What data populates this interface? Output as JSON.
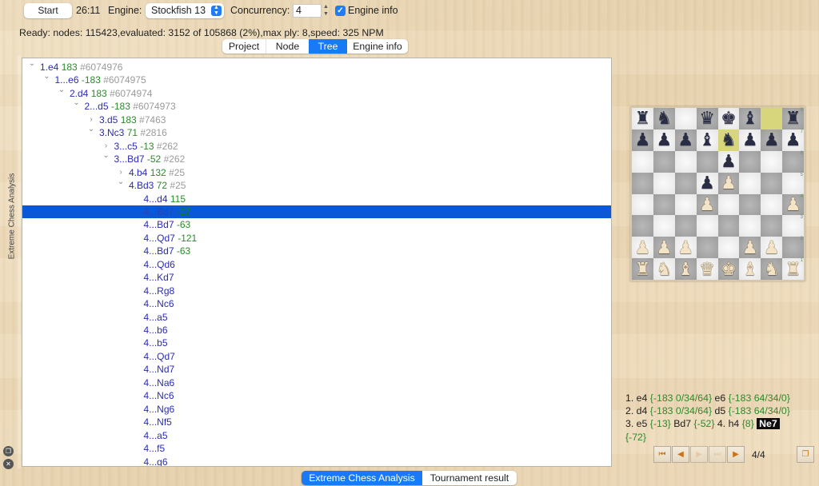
{
  "toolbar": {
    "start_label": "Start",
    "timer": "26:11",
    "engine_label": "Engine:",
    "engine_value": "Stockfish 13",
    "concurrency_label": "Concurrency:",
    "concurrency_value": "4",
    "engine_info_checkbox_label": "Engine info",
    "engine_info_checked": true
  },
  "status": "Ready: nodes: 115423,evaluated: 3152 of 105868 (2%),max ply: 8,speed: 325 NPM",
  "view_tabs": [
    {
      "label": "Project",
      "active": false
    },
    {
      "label": "Node",
      "active": false
    },
    {
      "label": "Tree",
      "active": true
    },
    {
      "label": "Engine info",
      "active": false
    }
  ],
  "side_panel_label": "Extreme Chess Analysis",
  "tree": [
    {
      "depth": 0,
      "toggle": "expanded",
      "move": "1.e4",
      "score": "183",
      "count": "#6074976"
    },
    {
      "depth": 1,
      "toggle": "expanded",
      "move": "1...e6",
      "score": "-183",
      "count": "#6074975"
    },
    {
      "depth": 2,
      "toggle": "expanded",
      "move": "2.d4",
      "score": "183",
      "count": "#6074974"
    },
    {
      "depth": 3,
      "toggle": "expanded",
      "move": "2...d5",
      "score": "-183",
      "count": "#6074973"
    },
    {
      "depth": 4,
      "toggle": "collapsed",
      "move": "3.d5",
      "score": "183",
      "count": "#7463"
    },
    {
      "depth": 4,
      "toggle": "expanded",
      "move": "3.Nc3",
      "score": "71",
      "count": "#2816"
    },
    {
      "depth": 5,
      "toggle": "collapsed",
      "move": "3...c5",
      "score": "-13",
      "count": "#262"
    },
    {
      "depth": 5,
      "toggle": "expanded",
      "move": "3...Bd7",
      "score": "-52",
      "count": "#262"
    },
    {
      "depth": 6,
      "toggle": "collapsed",
      "move": "4.b4",
      "score": "132",
      "count": "#25"
    },
    {
      "depth": 6,
      "toggle": "expanded",
      "move": "4.Bd3",
      "score": "72",
      "count": "#25"
    },
    {
      "depth": 7,
      "toggle": "",
      "move": "4...d4",
      "score": "115",
      "count": ""
    },
    {
      "depth": 7,
      "toggle": "",
      "move": "4...Bd7",
      "score": "-27",
      "count": "",
      "selected": true
    },
    {
      "depth": 7,
      "toggle": "",
      "move": "4...Bd7",
      "score": "-63",
      "count": ""
    },
    {
      "depth": 7,
      "toggle": "",
      "move": "4...Qd7",
      "score": "-121",
      "count": ""
    },
    {
      "depth": 7,
      "toggle": "",
      "move": "4...Bd7",
      "score": "-63",
      "count": ""
    },
    {
      "depth": 7,
      "toggle": "",
      "move": "4...Qd6",
      "score": "",
      "count": ""
    },
    {
      "depth": 7,
      "toggle": "",
      "move": "4...Kd7",
      "score": "",
      "count": ""
    },
    {
      "depth": 7,
      "toggle": "",
      "move": "4...Rg8",
      "score": "",
      "count": ""
    },
    {
      "depth": 7,
      "toggle": "",
      "move": "4...Nc6",
      "score": "",
      "count": ""
    },
    {
      "depth": 7,
      "toggle": "",
      "move": "4...a5",
      "score": "",
      "count": ""
    },
    {
      "depth": 7,
      "toggle": "",
      "move": "4...b6",
      "score": "",
      "count": ""
    },
    {
      "depth": 7,
      "toggle": "",
      "move": "4...b5",
      "score": "",
      "count": ""
    },
    {
      "depth": 7,
      "toggle": "",
      "move": "4...Qd7",
      "score": "",
      "count": ""
    },
    {
      "depth": 7,
      "toggle": "",
      "move": "4...Nd7",
      "score": "",
      "count": ""
    },
    {
      "depth": 7,
      "toggle": "",
      "move": "4...Na6",
      "score": "",
      "count": ""
    },
    {
      "depth": 7,
      "toggle": "",
      "move": "4...Nc6",
      "score": "",
      "count": ""
    },
    {
      "depth": 7,
      "toggle": "",
      "move": "4...Ng6",
      "score": "",
      "count": ""
    },
    {
      "depth": 7,
      "toggle": "",
      "move": "4...Nf5",
      "score": "",
      "count": ""
    },
    {
      "depth": 7,
      "toggle": "",
      "move": "4...a5",
      "score": "",
      "count": ""
    },
    {
      "depth": 7,
      "toggle": "",
      "move": "4...f5",
      "score": "",
      "count": ""
    },
    {
      "depth": 7,
      "toggle": "",
      "move": "4...g6",
      "score": "",
      "count": ""
    }
  ],
  "board": {
    "ranks": [
      [
        "r",
        "n",
        "",
        "q",
        "k",
        "b",
        "",
        "r"
      ],
      [
        "p",
        "p",
        "p",
        "b",
        "n",
        "p",
        "p",
        "p"
      ],
      [
        "",
        "",
        "",
        "",
        "p",
        "",
        "",
        ""
      ],
      [
        "",
        "",
        "",
        "p",
        "P",
        "",
        "",
        ""
      ],
      [
        "",
        "",
        "",
        "P",
        "",
        "",
        "",
        "P"
      ],
      [
        "",
        "",
        "",
        "",
        "",
        "",
        "",
        ""
      ],
      [
        "P",
        "P",
        "P",
        "",
        "",
        "P",
        "P",
        ""
      ],
      [
        "R",
        "N",
        "B",
        "Q",
        "K",
        "B",
        "N",
        "R"
      ]
    ],
    "highlighted_squares": [
      "g8",
      "e7"
    ],
    "rank_labels": [
      "8",
      "7",
      "6",
      "5",
      "4",
      "3",
      "2",
      "1"
    ],
    "file_labels": [
      "a",
      "b",
      "c",
      "d",
      "e",
      "f",
      "g",
      "h"
    ]
  },
  "pgn": [
    {
      "t": "1. e4 ",
      "k": "mv"
    },
    {
      "t": "{-183 0/34/64}",
      "k": "cm"
    },
    {
      "t": " e6 ",
      "k": "mv"
    },
    {
      "t": "{-183 64/34/0}",
      "k": "cm"
    },
    {
      "t": "br",
      "k": "br"
    },
    {
      "t": " 2. d4 ",
      "k": "mv"
    },
    {
      "t": "{-183 0/34/64}",
      "k": "cm"
    },
    {
      "t": " d5 ",
      "k": "mv"
    },
    {
      "t": "{-183 64/34/0}",
      "k": "cm"
    },
    {
      "t": "br",
      "k": "br"
    },
    {
      "t": " 3. e5 ",
      "k": "mv"
    },
    {
      "t": "{-13}",
      "k": "cm"
    },
    {
      "t": " Bd7 ",
      "k": "mv"
    },
    {
      "t": "{-52}",
      "k": "cm"
    },
    {
      "t": "  4. h4 ",
      "k": "mv"
    },
    {
      "t": "{8}",
      "k": "cm"
    },
    {
      "t": " ",
      "k": "mv"
    },
    {
      "t": "Ne7",
      "k": "cur"
    },
    {
      "t": "br",
      "k": "br"
    },
    {
      "t": "{-72}",
      "k": "cm"
    }
  ],
  "navigation": {
    "buttons": [
      {
        "name": "first-move",
        "glyph": "⏮",
        "enabled": true
      },
      {
        "name": "previous-move",
        "glyph": "◀",
        "enabled": true
      },
      {
        "name": "next-move",
        "glyph": "▶",
        "enabled": false
      },
      {
        "name": "last-move",
        "glyph": "⏭",
        "enabled": false
      },
      {
        "name": "play-engine-move",
        "glyph": "▶",
        "enabled": true
      }
    ],
    "position": "4/4",
    "copy_glyph": "❐"
  },
  "bottom_tabs": [
    {
      "label": "Extreme Chess Analysis",
      "active": true
    },
    {
      "label": "Tournament result",
      "active": false
    }
  ],
  "colors": {
    "accent": "#1a7af5",
    "selection": "#0a58d6",
    "move_text": "#2a2ab8",
    "score_text": "#2b8a2b",
    "count_text": "#9a9a9a",
    "highlight_square": "#d8d67c"
  }
}
